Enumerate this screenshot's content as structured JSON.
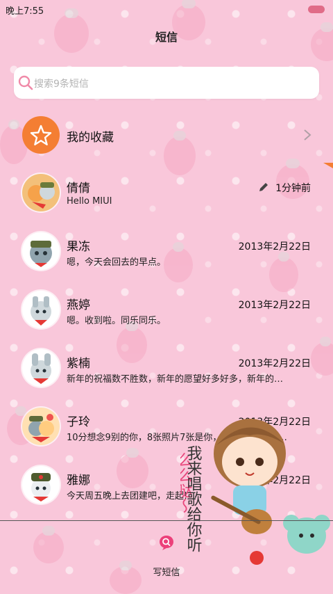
{
  "status_bar": {
    "time": "晚上7:55"
  },
  "header": {
    "title": "短信"
  },
  "search": {
    "placeholder": "搜索9条短信"
  },
  "favorites": {
    "label": "我的收藏"
  },
  "conversations": [
    {
      "name": "倩倩",
      "time": "1分钟前",
      "preview": "Hello MIUI",
      "draft": true
    },
    {
      "name": "果冻",
      "time": "2013年2月22日",
      "preview": "嗯，今天会回去的早点。"
    },
    {
      "name": "燕婷",
      "time": "2013年2月22日",
      "preview": "嗯。收到啦。同乐同乐。"
    },
    {
      "name": "紫楠",
      "time": "2013年2月22日",
      "preview": "新年的祝福数不胜数，新年的愿望好多好多，新年的…"
    },
    {
      "name": "子玲",
      "time": "2013年2月22日",
      "preview": "10分想念9别的你，8张照片7张是你，6只小狗5只像…"
    },
    {
      "name": "雅娜",
      "time": "2013年2月22日",
      "preview": "今天周五晚上去团建吧，走起!"
    }
  ],
  "bottom_bar": {
    "compose_label": "写短信"
  },
  "decoration": {
    "text_right": "我来唱歌给你听",
    "text_left": "么么哒～"
  },
  "colors": {
    "accent": "#f47e33",
    "background": "#f9c7da",
    "search_icon": "#f08aa8"
  }
}
